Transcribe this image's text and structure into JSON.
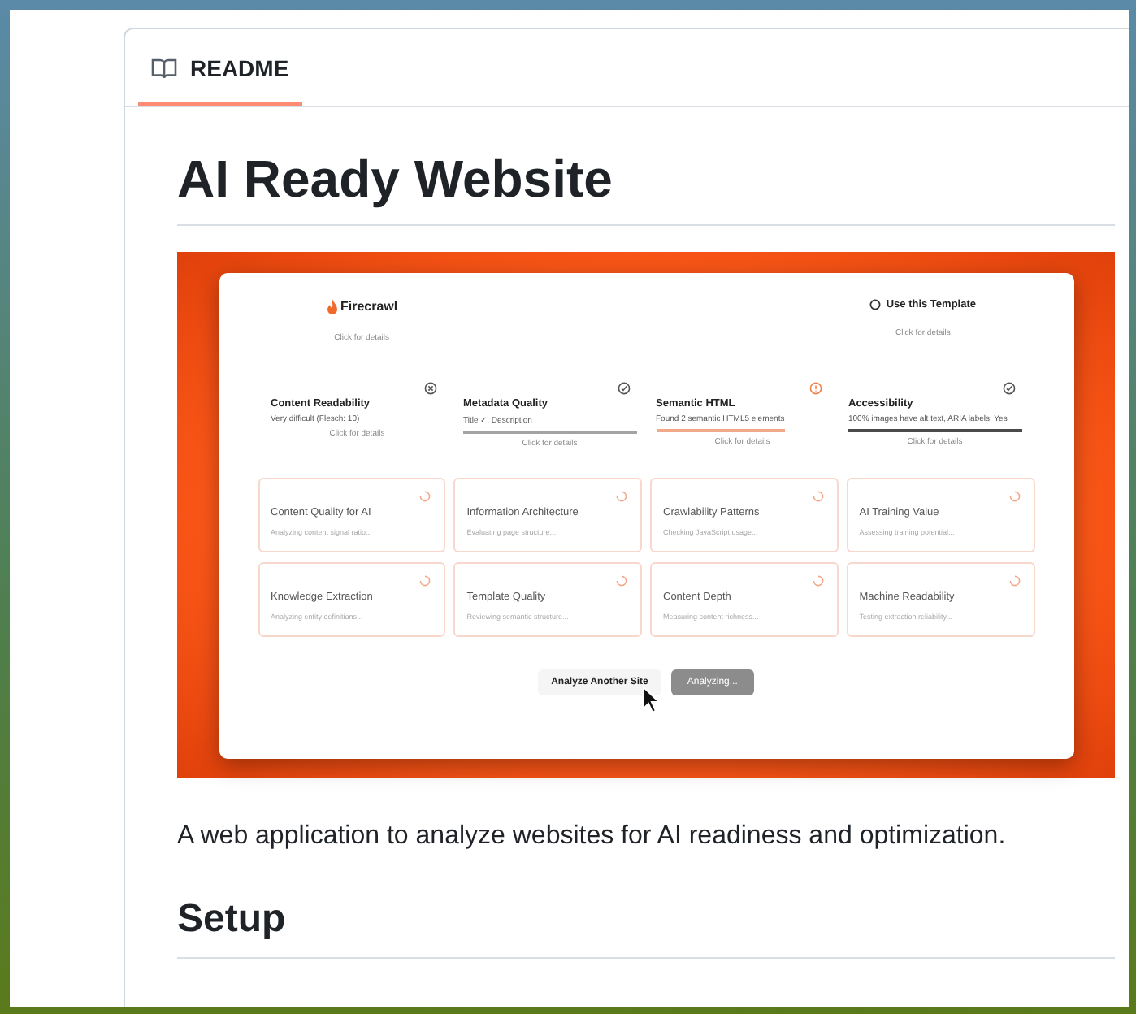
{
  "tab": {
    "label": "README",
    "selected": true
  },
  "title": "AI Ready Website",
  "screenshot": {
    "brand": "Firecrawl",
    "brand_hint": "Click for details",
    "template_link": "Use this Template",
    "template_hint": "Click for details",
    "metrics": [
      {
        "title": "Content Readability",
        "detail": "Very difficult (Flesch: 10)",
        "hint": "Click for details",
        "kind": "fail"
      },
      {
        "title": "Metadata Quality",
        "detail": "Title ✓, Description",
        "hint": "Click for details",
        "kind": "pass",
        "color": "#a3a3a3"
      },
      {
        "title": "Semantic HTML",
        "detail": "Found 2 semantic HTML5 elements",
        "hint": "Click for details",
        "kind": "warn",
        "color": "#f2a98a"
      },
      {
        "title": "Accessibility",
        "detail": "100% images have alt text, ARIA labels: Yes",
        "hint": "Click for details",
        "kind": "pass",
        "color": "#4a4a4a"
      }
    ],
    "cards": [
      {
        "title": "Content Quality for AI",
        "detail": "Analyzing content signal ratio..."
      },
      {
        "title": "Information Architecture",
        "detail": "Evaluating page structure..."
      },
      {
        "title": "Crawlability Patterns",
        "detail": "Checking JavaScript usage..."
      },
      {
        "title": "AI Training Value",
        "detail": "Assessing training potential..."
      },
      {
        "title": "Knowledge Extraction",
        "detail": "Analyzing entity definitions..."
      },
      {
        "title": "Template Quality",
        "detail": "Reviewing semantic structure..."
      },
      {
        "title": "Content Depth",
        "detail": "Measuring content richness..."
      },
      {
        "title": "Machine Readability",
        "detail": "Testing extraction reliability..."
      }
    ],
    "buttons": [
      {
        "label": "Analyze Another Site",
        "kind": "secondary"
      },
      {
        "label": "Analyzing...",
        "kind": "busy"
      }
    ]
  },
  "description": "A web application to analyze websites for AI readiness and optimization.",
  "section": "Setup"
}
